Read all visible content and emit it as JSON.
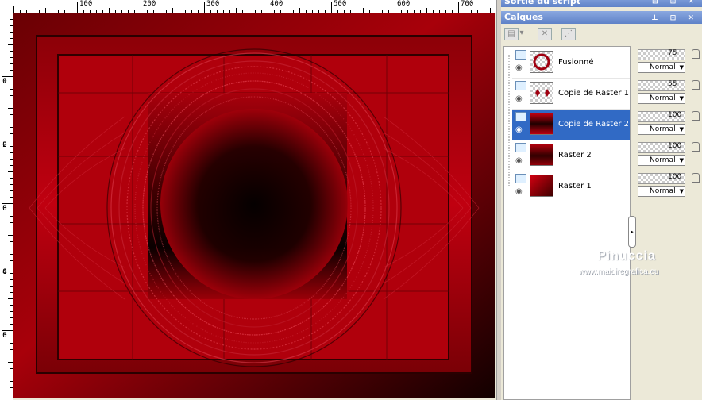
{
  "ruler": {
    "top_labels": [
      "100",
      "200",
      "300",
      "400",
      "500",
      "600",
      "700"
    ],
    "left_labels": [
      [
        "1",
        "0",
        "0"
      ],
      [
        "2",
        "0",
        "0"
      ],
      [
        "3",
        "0",
        "0"
      ],
      [
        "4",
        "0",
        "0"
      ],
      [
        "5",
        "0",
        "0"
      ]
    ]
  },
  "panel": {
    "script_title": "Sortie du script",
    "layers_title": "Calques"
  },
  "layers": [
    {
      "name": "Fusionné",
      "opacity": "75",
      "blend": "Normal"
    },
    {
      "name": "Copie de Raster 1",
      "opacity": "55",
      "blend": "Normal"
    },
    {
      "name": "Copie de Raster 2",
      "opacity": "100",
      "blend": "Normal"
    },
    {
      "name": "Raster 2",
      "opacity": "100",
      "blend": "Normal"
    },
    {
      "name": "Raster 1",
      "opacity": "100",
      "blend": "Normal"
    }
  ],
  "watermark": {
    "name": "Pinuccia",
    "url": "www.maidiregrafica.eu"
  },
  "colors": {
    "accent": "#316ac5",
    "canvas_red": "#b00008",
    "canvas_dark": "#1a0000",
    "titlebar": "#6f8fd0"
  }
}
